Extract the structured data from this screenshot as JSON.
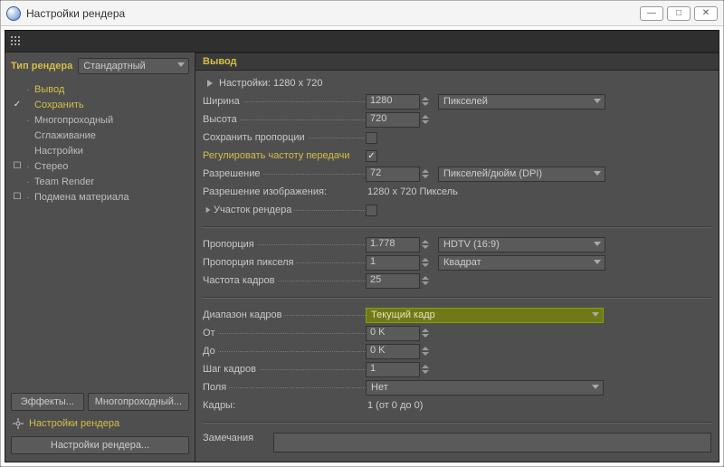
{
  "window": {
    "title": "Настройки рендера"
  },
  "sidebar": {
    "rendertype_label": "Тип рендера",
    "rendertype_value": "Стандартный",
    "items": [
      {
        "label": "Вывод",
        "check": "",
        "selected": true,
        "expander": "-"
      },
      {
        "label": "Сохранить",
        "check": "✓",
        "selected": true,
        "expander": ""
      },
      {
        "label": "Многопроходный",
        "check": "",
        "selected": false,
        "expander": "-"
      },
      {
        "label": "Сглаживание",
        "check": "",
        "selected": false,
        "expander": ""
      },
      {
        "label": "Настройки",
        "check": "",
        "selected": false,
        "expander": ""
      },
      {
        "label": "Стерео",
        "check": "☐",
        "selected": false,
        "expander": "-"
      },
      {
        "label": "Team Render",
        "check": "",
        "selected": false,
        "expander": "-"
      },
      {
        "label": "Подмена материала",
        "check": "☐",
        "selected": false,
        "expander": "-"
      }
    ],
    "effects_btn": "Эффекты...",
    "multipass_btn": "Многопроходный...",
    "render_settings_label": "Настройки рендера",
    "bottom_btn": "Настройки рендера..."
  },
  "main": {
    "title": "Вывод",
    "preset_label": "Настройки: 1280 x 720",
    "width_label": "Ширина",
    "width_value": "1280",
    "width_unit": "Пикселей",
    "height_label": "Высота",
    "height_value": "720",
    "aspect_lock_label": "Сохранить пропорции",
    "aspect_lock_checked": "",
    "adjust_rate_label": "Регулировать частоту передачи",
    "adjust_rate_checked": "✓",
    "resolution_label": "Разрешение",
    "resolution_value": "72",
    "resolution_unit": "Пикселей/дюйм (DPI)",
    "image_res_label": "Разрешение изображения:",
    "image_res_value": "1280 x 720 Пиксель",
    "region_label": "Участок рендера",
    "region_checked": "",
    "ratio_label": "Пропорция",
    "ratio_value": "1.778",
    "ratio_unit": "HDTV (16:9)",
    "pixel_ratio_label": "Пропорция пикселя",
    "pixel_ratio_value": "1",
    "pixel_ratio_unit": "Квадрат",
    "fps_label": "Частота кадров",
    "fps_value": "25",
    "frame_range_label": "Диапазон кадров",
    "frame_range_value": "Текущий кадр",
    "from_label": "От",
    "from_value": "0 K",
    "to_label": "До",
    "to_value": "0 K",
    "step_label": "Шаг кадров",
    "step_value": "1",
    "fields_label": "Поля",
    "fields_value": "Нет",
    "frames_label": "Кадры:",
    "frames_value": "1 (от 0 до 0)",
    "notes_label": "Замечания"
  }
}
